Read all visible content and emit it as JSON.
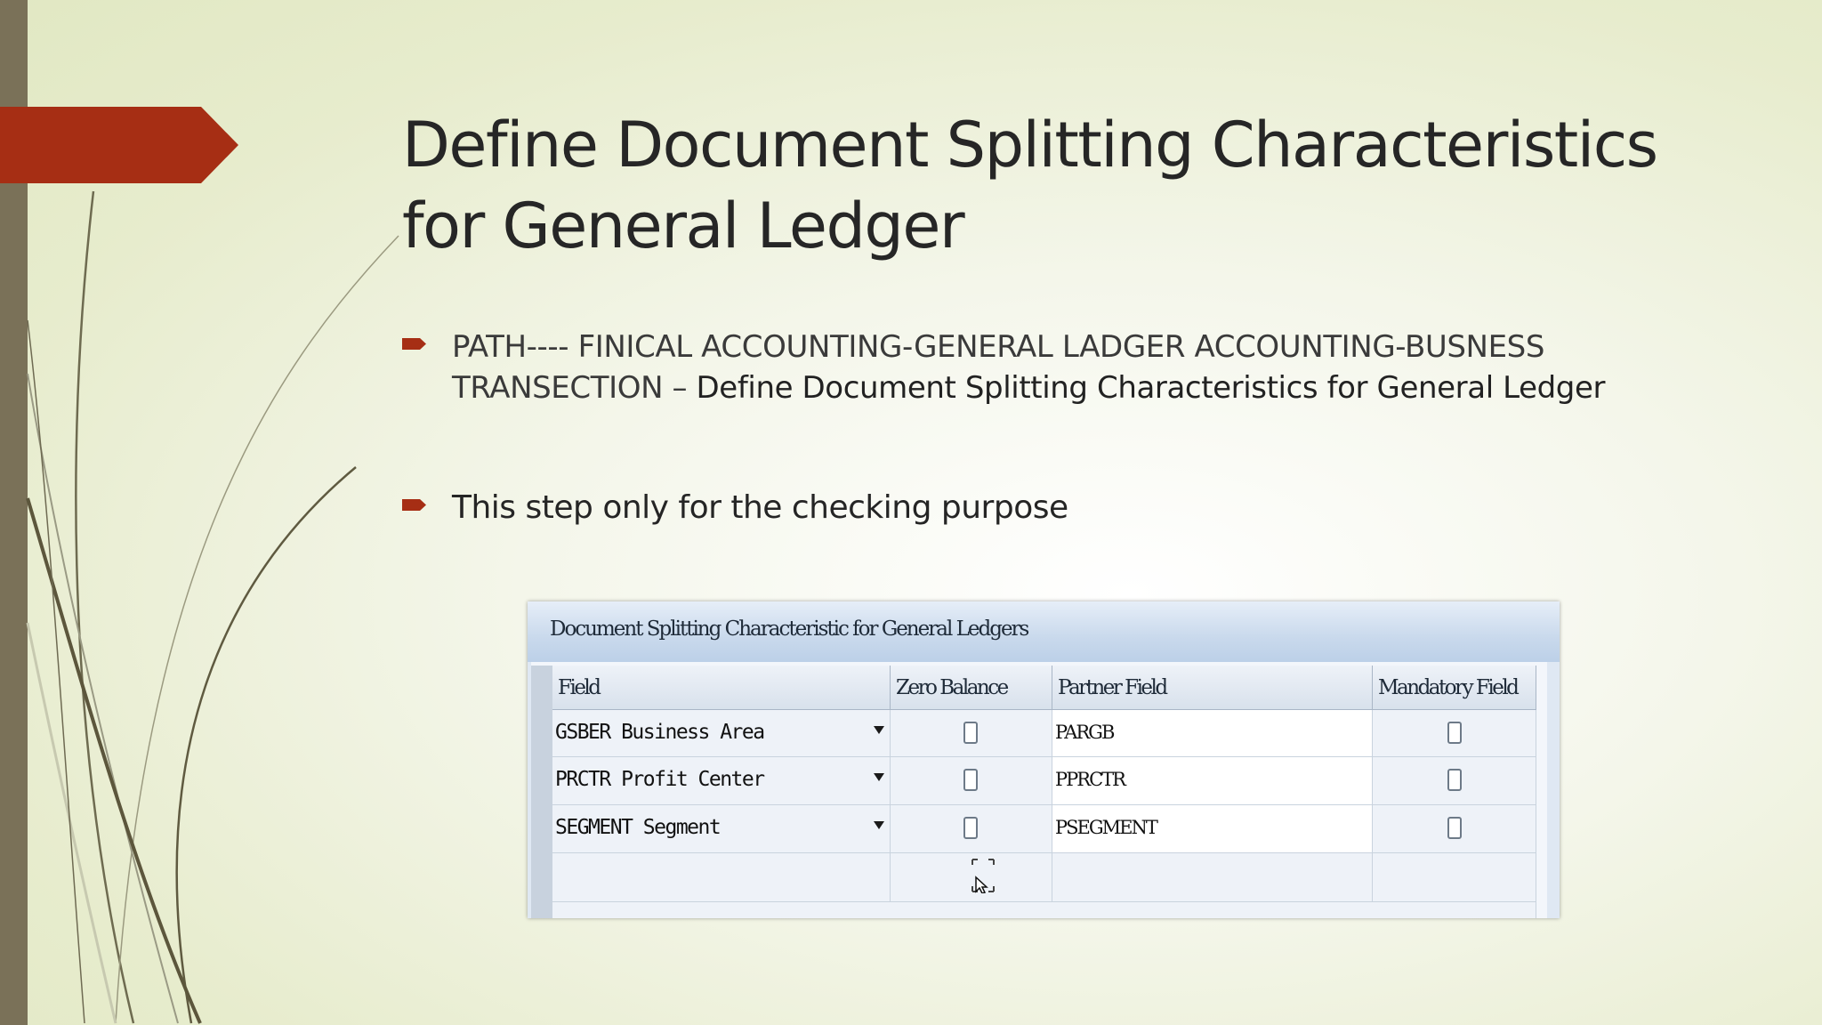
{
  "slide": {
    "title_line1": "Define Document Splitting Characteristics",
    "title_line2": "for General Ledger",
    "bullets": [
      {
        "text_line1": "PATH---- FINICAL ACCOUNTING-GENERAL LADGER ACCOUNTING-BUSNESS",
        "text_line2_plain": "TRANSECTION – ",
        "text_line2_strong": "Define Document Splitting Characteristics for General Ledger"
      },
      {
        "text": "This step only for the checking purpose"
      }
    ]
  },
  "sap_window": {
    "title": "Document Splitting Characteristic for General Ledgers",
    "columns": [
      "Field",
      "Zero Balance",
      "Partner Field",
      "Mandatory Field"
    ],
    "rows": [
      {
        "field": "GSBER Business Area",
        "zero_balance": false,
        "partner_field": "PARGB",
        "mandatory": false
      },
      {
        "field": "PRCTR Profit Center",
        "zero_balance": false,
        "partner_field": "PPRCTR",
        "mandatory": false
      },
      {
        "field": "SEGMENT Segment",
        "zero_balance": false,
        "partner_field": "PSEGMENT",
        "mandatory": false
      }
    ]
  },
  "colors": {
    "accent": "#a62e14",
    "sidebar": "#7a7158",
    "background": "#e5ebcb"
  }
}
